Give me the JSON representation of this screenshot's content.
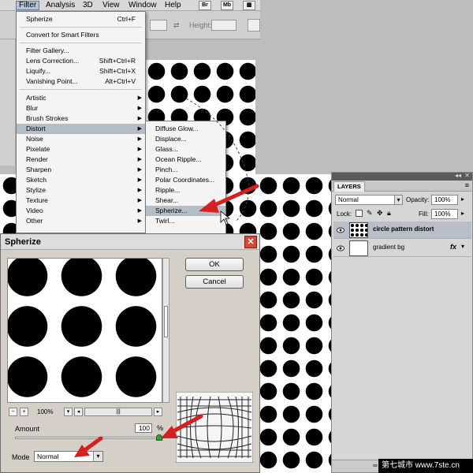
{
  "menubar": {
    "items": [
      "Filter",
      "Analysis",
      "3D",
      "View",
      "Window",
      "Help"
    ],
    "br": "Br",
    "mb": "Mb"
  },
  "optionbar": {
    "height_label": "Height:"
  },
  "filter_menu": {
    "items": [
      {
        "label": "Spherize",
        "shortcut": "Ctrl+F"
      },
      {
        "label": "Convert for Smart Filters"
      },
      {
        "label": "Filter Gallery..."
      },
      {
        "label": "Lens Correction...",
        "shortcut": "Shift+Ctrl+R"
      },
      {
        "label": "Liquify...",
        "shortcut": "Shift+Ctrl+X"
      },
      {
        "label": "Vanishing Point...",
        "shortcut": "Alt+Ctrl+V"
      },
      {
        "label": "Artistic"
      },
      {
        "label": "Blur"
      },
      {
        "label": "Brush Strokes"
      },
      {
        "label": "Distort"
      },
      {
        "label": "Noise"
      },
      {
        "label": "Pixelate"
      },
      {
        "label": "Render"
      },
      {
        "label": "Sharpen"
      },
      {
        "label": "Sketch"
      },
      {
        "label": "Stylize"
      },
      {
        "label": "Texture"
      },
      {
        "label": "Video"
      },
      {
        "label": "Other"
      }
    ]
  },
  "distort_menu": {
    "items": [
      "Diffuse Glow...",
      "Displace...",
      "Glass...",
      "Ocean Ripple...",
      "Pinch...",
      "Polar Coordinates...",
      "Ripple...",
      "Shear...",
      "Spherize...",
      "Twirl..."
    ]
  },
  "dialog": {
    "title": "Spherize",
    "ok": "OK",
    "cancel": "Cancel",
    "zoom": "100%",
    "amount_label": "Amount",
    "amount_value": "100",
    "amount_unit": "%",
    "amount_level": 1.0,
    "mode_label": "Mode",
    "mode_value": "Normal"
  },
  "layers": {
    "tab": "LAYERS",
    "blend_mode": "Normal",
    "opacity_label": "Opacity:",
    "opacity_value": "100%",
    "lock_label": "Lock:",
    "fill_label": "Fill:",
    "fill_value": "100%",
    "rows": [
      {
        "name": "circle pattern distort"
      },
      {
        "name": "gradient bg",
        "fx": "fx"
      }
    ]
  },
  "watermark": "第七城市 www.7ste.cn",
  "colors": {
    "accent_arrow": "#d42020",
    "menu_highlight": "#b5bdc9",
    "dialog_bg": "#d4d0c8"
  }
}
